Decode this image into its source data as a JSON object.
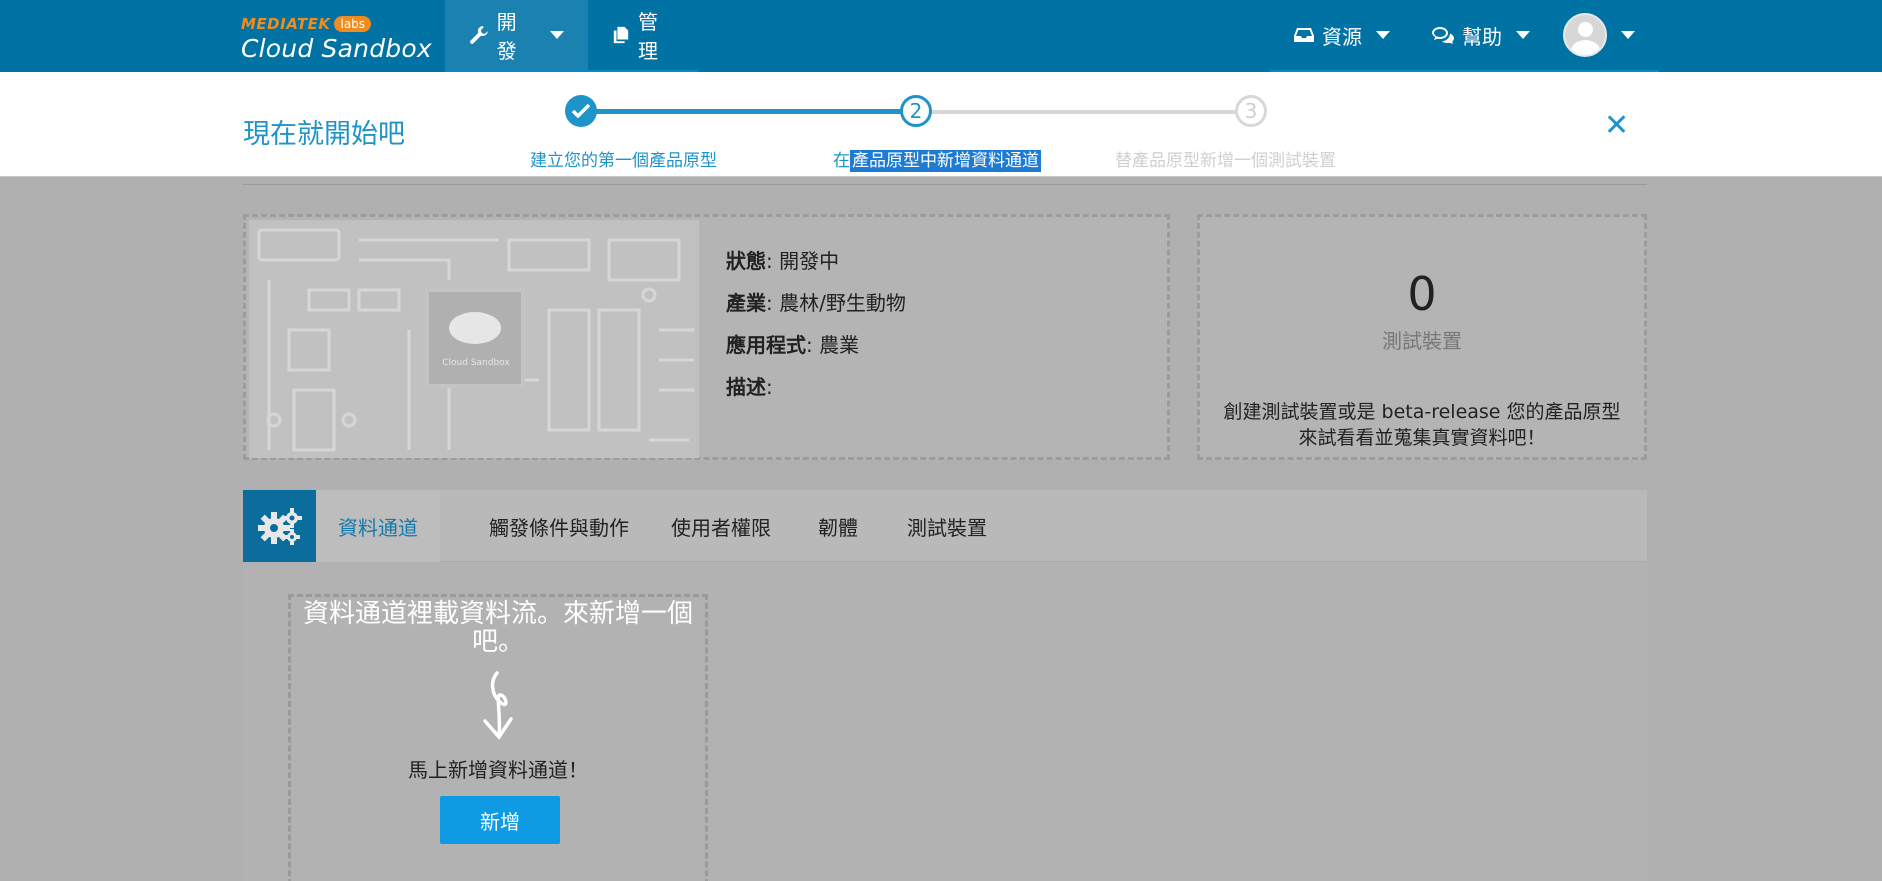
{
  "logo": {
    "brand": "MEDIATEK",
    "labs": "labs",
    "product": "Cloud Sandbox"
  },
  "nav": {
    "develop": "開發",
    "manage": "管理",
    "resources": "資源",
    "help": "幫助"
  },
  "wizard": {
    "title": "現在就開始吧",
    "steps": [
      {
        "number": "",
        "label": "建立您的第一個產品原型",
        "state": "done"
      },
      {
        "number": "2",
        "label_prefix": "在",
        "label_selected": "產品原型中新增資料通道",
        "state": "current"
      },
      {
        "number": "3",
        "label": "替產品原型新增一個測試裝置",
        "state": "pending"
      }
    ]
  },
  "prototype": {
    "status_label": "狀態",
    "status_value": "開發中",
    "industry_label": "產業",
    "industry_value": "農林/野生動物",
    "app_label": "應用程式",
    "app_value": "農業",
    "desc_label": "描述",
    "desc_value": "",
    "board_chip": "Cloud Sandbox"
  },
  "test_devices": {
    "count": "0",
    "label": "測試裝置",
    "hint_line1": "創建測試裝置或是 beta-release 您的產品原型",
    "hint_line2": "來試看看並蒐集真實資料吧！"
  },
  "tabs": [
    "資料通道",
    "觸發條件與動作",
    "使用者權限",
    "韌體",
    "測試裝置"
  ],
  "empty_state": {
    "line1": "資料通道裡載資料流。來新增一個",
    "line2": "吧。",
    "cta_text": "馬上新增資料通道！",
    "button": "新增"
  },
  "colors": {
    "nav_bg": "#0072a3",
    "accent": "#1e94c9",
    "button": "#0f9be3"
  }
}
